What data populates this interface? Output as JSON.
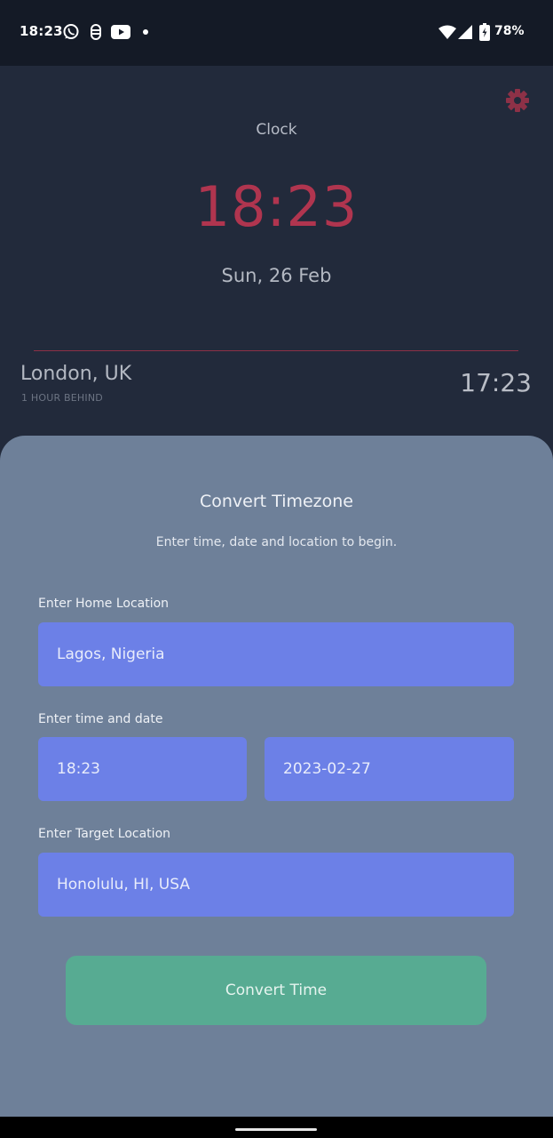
{
  "status_bar": {
    "time": "18:23",
    "notification_icons": [
      "whatsapp-icon",
      "recorder-icon",
      "youtube-icon",
      "dot-icon"
    ],
    "system_icons": [
      "wifi-icon",
      "signal-icon",
      "battery-icon"
    ],
    "battery": "78%"
  },
  "header": {
    "title": "Clock",
    "settings_icon": "gear-icon",
    "accent_color": "#b0354f"
  },
  "clock": {
    "time": "18:23",
    "date": "Sun, 26 Feb"
  },
  "world_clock": {
    "city": "London, UK",
    "difference": "1 HOUR BEHIND",
    "time": "17:23"
  },
  "sheet": {
    "title": "Convert Timezone",
    "subtitle": "Enter time, date and location to begin.",
    "home_label": "Enter Home Location",
    "home_value": "Lagos, Nigeria",
    "datetime_label": "Enter time and date",
    "time_value": "18:23",
    "date_value": "2023-02-27",
    "target_label": "Enter Target Location",
    "target_value": "Honolulu, HI, USA",
    "button_label": "Convert Time",
    "field_color": "#6c80e7",
    "button_color": "#57ab92"
  }
}
